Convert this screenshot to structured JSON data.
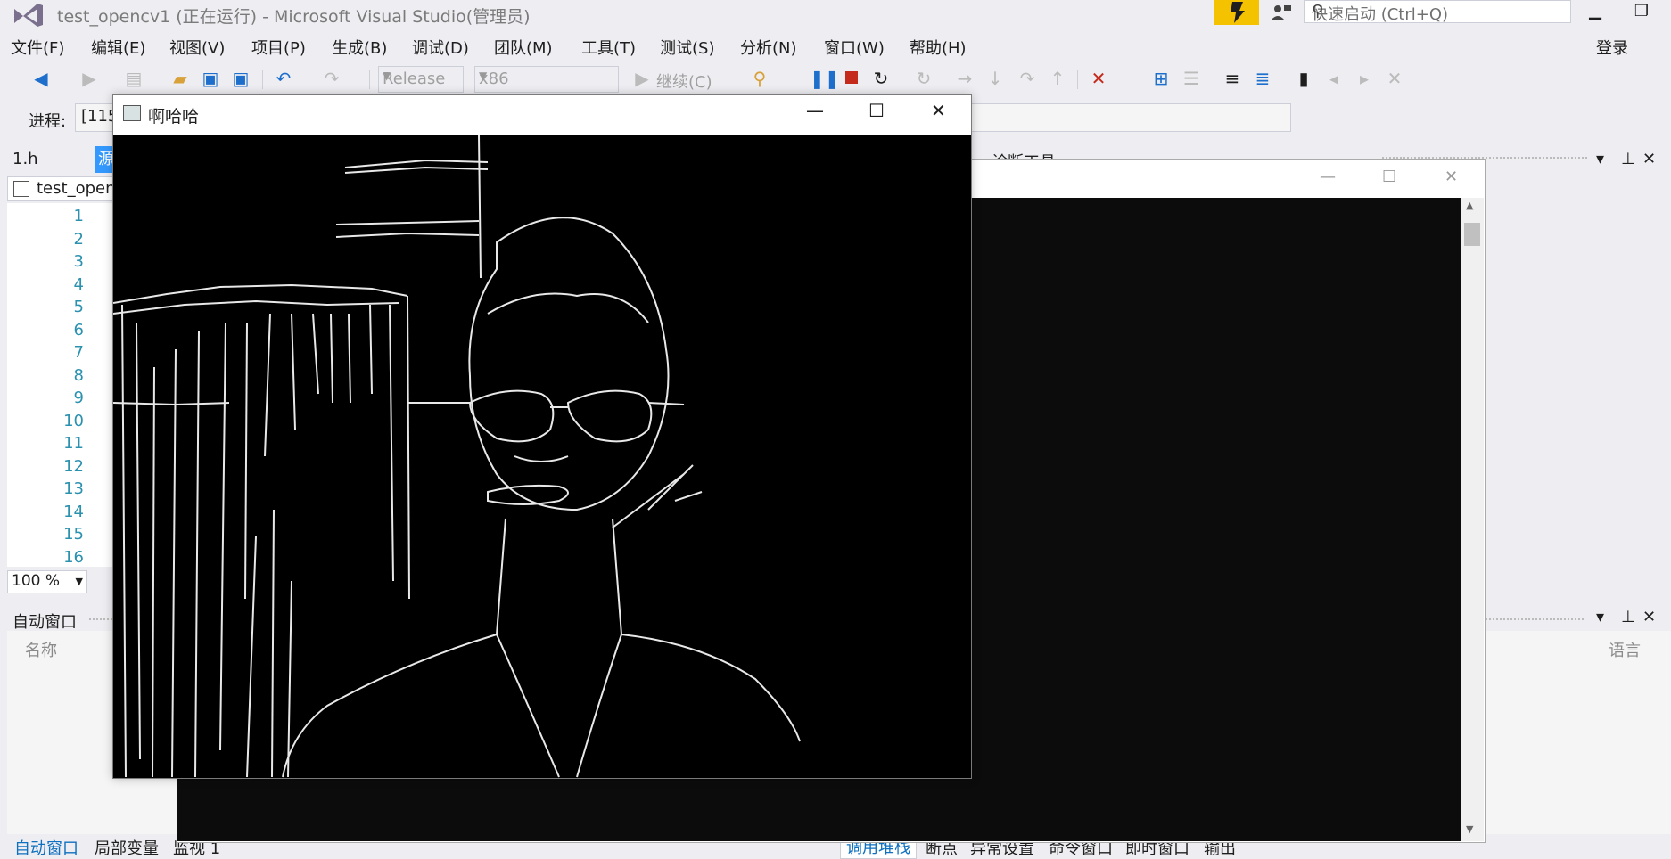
{
  "app": {
    "title": "test_opencv1 (正在运行) - Microsoft Visual Studio(管理员)",
    "quick_launch_placeholder": "快速启动 (Ctrl+Q)",
    "login_label": "登录"
  },
  "menu": [
    "文件(F)",
    "编辑(E)",
    "视图(V)",
    "项目(P)",
    "生成(B)",
    "调试(D)",
    "团队(M)",
    "工具(T)",
    "测试(S)",
    "分析(N)",
    "窗口(W)",
    "帮助(H)"
  ],
  "toolbar": {
    "config": "Release",
    "platform": "x86",
    "continue_label": "继续(C)"
  },
  "process": {
    "label": "进程:",
    "value": "[115"
  },
  "editor": {
    "tab_header": "1.h",
    "tab_source": "源",
    "nav_project": "test_openc",
    "line_numbers": [
      "1",
      "2",
      "3",
      "4",
      "5",
      "6",
      "7",
      "8",
      "9",
      "10",
      "11",
      "12",
      "13",
      "14",
      "15",
      "16"
    ],
    "zoom": "100 %"
  },
  "diagnostics": {
    "label": "诊断工具"
  },
  "auto_window": {
    "title": "自动窗口",
    "col_name": "名称",
    "col_lang": "语言",
    "tabs": [
      "自动窗口",
      "局部变量",
      "监视 1"
    ],
    "right_tabs": [
      "调用堆栈",
      "断点",
      "异常设置",
      "命令窗口",
      "即时窗口",
      "输出"
    ]
  },
  "opencv_window": {
    "title": "啊哈哈",
    "image_description_icon": "edge-detected-image"
  },
  "colors": {
    "accent": "#0e70c0",
    "badge": "#f5c200",
    "console_bg": "#0c0c0c",
    "stop_red": "#c42b1c",
    "pause_blue": "#1e6fcc"
  }
}
